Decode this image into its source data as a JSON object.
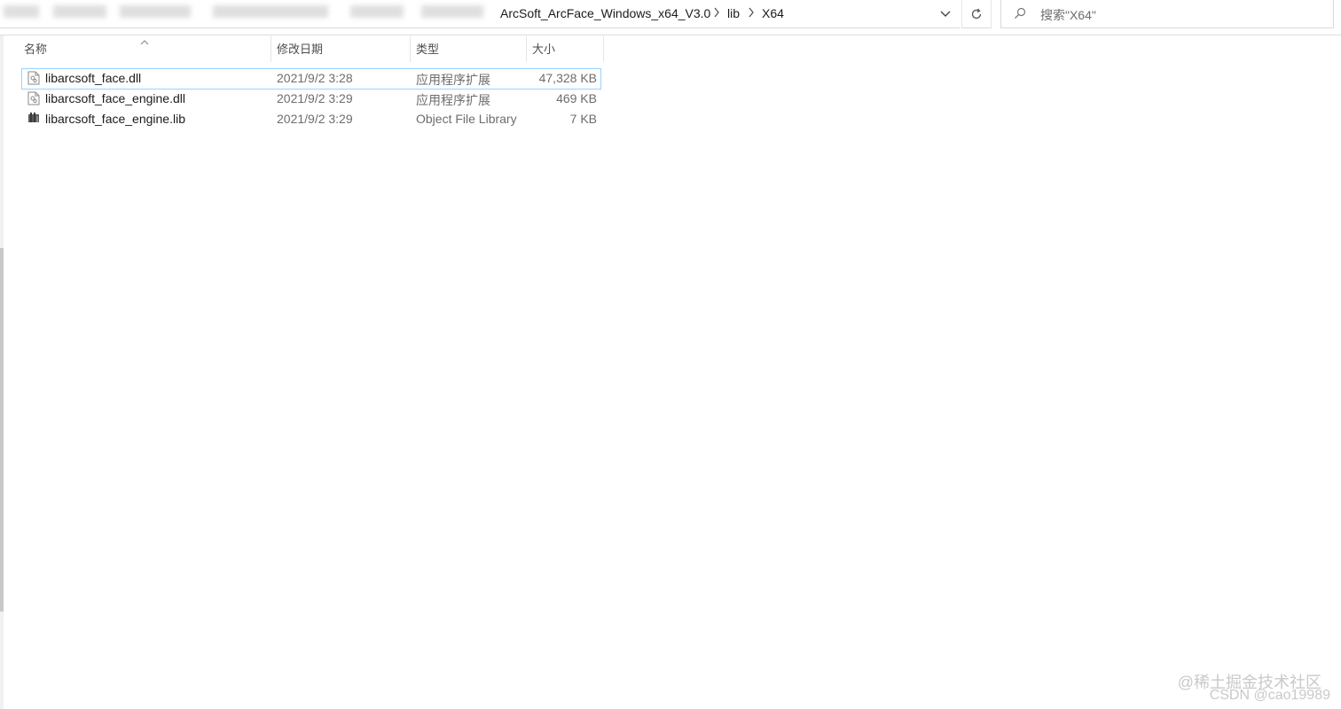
{
  "address_bar": {
    "breadcrumbs": [
      "ArcSoft_ArcFace_Windows_x64_V3.0",
      "lib",
      "X64"
    ],
    "separator_icon": "chevron-right-icon",
    "dropdown_icon": "chevron-down-icon",
    "refresh_icon": "refresh-icon"
  },
  "search": {
    "placeholder": "搜索\"X64\"",
    "icon": "search-icon"
  },
  "columns": {
    "name": "名称",
    "modified": "修改日期",
    "type": "类型",
    "size": "大小"
  },
  "files": [
    {
      "name": "libarcsoft_face.dll",
      "modified": "2021/9/2 3:28",
      "type": "应用程序扩展",
      "size": "47,328 KB",
      "icon": "dll-file-icon",
      "selected": true
    },
    {
      "name": "libarcsoft_face_engine.dll",
      "modified": "2021/9/2 3:29",
      "type": "应用程序扩展",
      "size": "469 KB",
      "icon": "dll-file-icon",
      "selected": false
    },
    {
      "name": "libarcsoft_face_engine.lib",
      "modified": "2021/9/2 3:29",
      "type": "Object File Library",
      "size": "7 KB",
      "icon": "lib-file-icon",
      "selected": false
    }
  ],
  "watermark": {
    "line1": "@稀土掘金技术社区",
    "line2": "CSDN @cao19989"
  },
  "colors": {
    "selection_border": "#99d1ff",
    "meta_text": "#6d6d6d"
  }
}
